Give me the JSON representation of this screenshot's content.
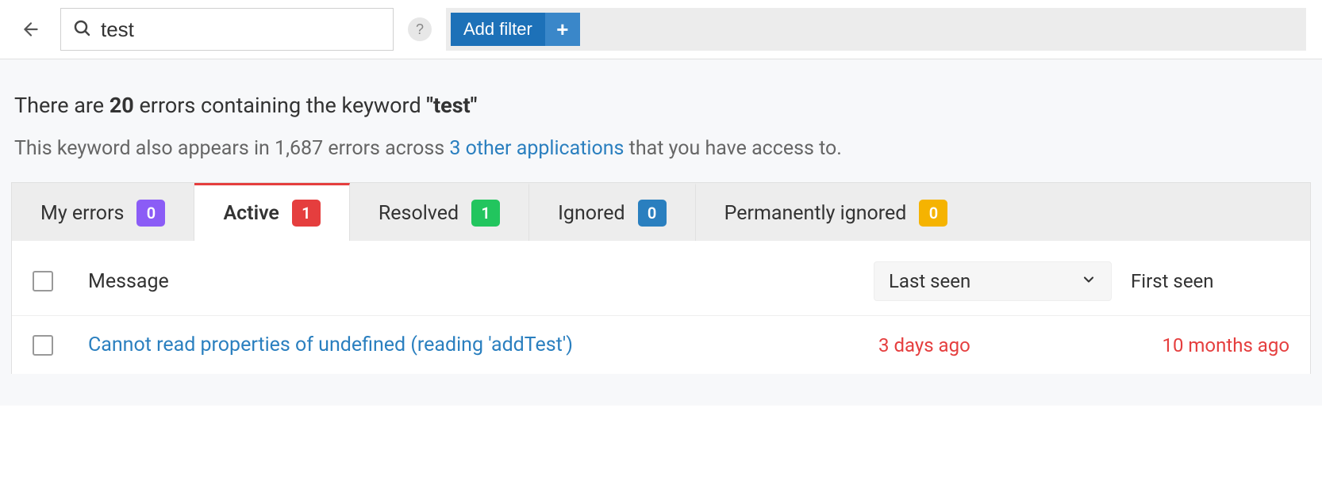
{
  "search": {
    "value": "test",
    "placeholder": ""
  },
  "filter": {
    "add_filter_label": "Add filter"
  },
  "summary": {
    "prefix": "There are ",
    "count": "20",
    "mid": " errors containing the keyword ",
    "keyword": "\"test\"",
    "line2_prefix": "This keyword also appears in 1,687 errors across ",
    "line2_link": "3 other applications",
    "line2_suffix": " that you have access to."
  },
  "tabs": [
    {
      "label": "My errors",
      "count": "0",
      "color": "purple",
      "active": false
    },
    {
      "label": "Active",
      "count": "1",
      "color": "red",
      "active": true
    },
    {
      "label": "Resolved",
      "count": "1",
      "color": "green",
      "active": false
    },
    {
      "label": "Ignored",
      "count": "0",
      "color": "blue",
      "active": false
    },
    {
      "label": "Permanently ignored",
      "count": "0",
      "color": "yellow",
      "active": false
    }
  ],
  "table": {
    "headers": {
      "message": "Message",
      "last_seen": "Last seen",
      "first_seen": "First seen"
    },
    "rows": [
      {
        "message": "Cannot read properties of undefined (reading 'addTest')",
        "last_seen": "3 days ago",
        "first_seen": "10 months ago"
      }
    ]
  }
}
